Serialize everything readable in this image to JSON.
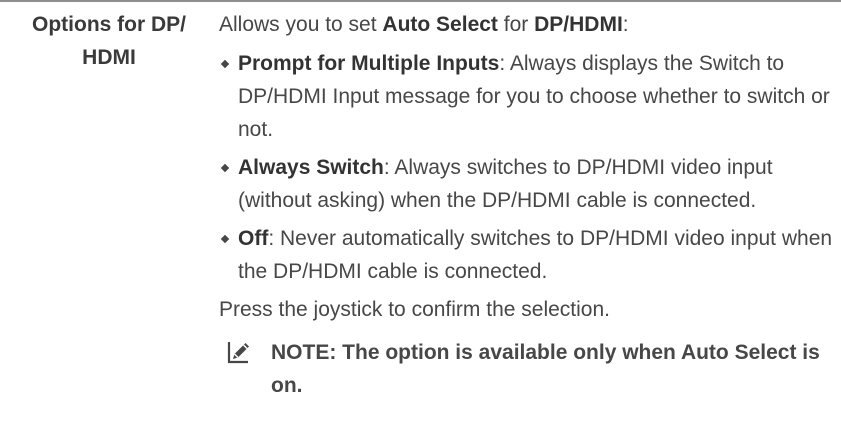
{
  "term": {
    "line1": "Options for DP/",
    "line2": "HDMI"
  },
  "intro": {
    "prefix": "Allows you to set ",
    "bold1": "Auto Select",
    "middle": " for ",
    "bold2": "DP/HDMI",
    "suffix": ":"
  },
  "bullets": [
    {
      "title": "Prompt for Multiple Inputs",
      "text": ": Always displays the Switch to DP/HDMI Input message for you to choose whether to switch or not."
    },
    {
      "title": "Always Switch",
      "text": ": Always switches to DP/HDMI video input (without asking) when the DP/HDMI cable is connected."
    },
    {
      "title": "Off",
      "text": ": Never automatically switches to DP/HDMI video input when the DP/HDMI cable is connected."
    }
  ],
  "confirm": "Press the joystick to confirm the selection.",
  "note": {
    "icon": "pencil-note-icon",
    "text": "NOTE: The option is available only when Auto Select is on."
  }
}
